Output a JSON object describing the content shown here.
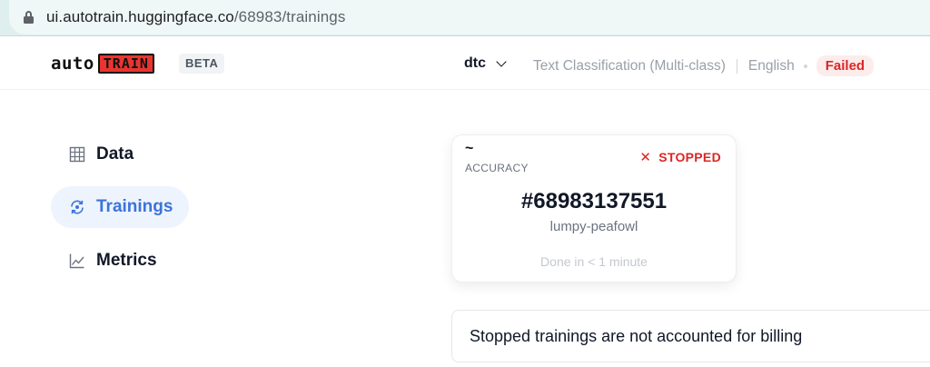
{
  "browser": {
    "url_host": "ui.autotrain.huggingface.co",
    "url_path": "/68983/trainings"
  },
  "header": {
    "logo_auto": "auto",
    "logo_train": "TRAIN",
    "beta_label": "BETA",
    "project_name": "dtc",
    "task": "Text Classification (Multi-class)",
    "language": "English",
    "status": "Failed"
  },
  "sidebar": {
    "items": [
      {
        "label": "Data",
        "icon": "grid-icon",
        "active": false
      },
      {
        "label": "Trainings",
        "icon": "refresh-icon",
        "active": true
      },
      {
        "label": "Metrics",
        "icon": "chart-line-icon",
        "active": false
      }
    ]
  },
  "training_card": {
    "metric_value": "~",
    "metric_label": "ACCURACY",
    "status": "STOPPED",
    "run_id": "#68983137551",
    "run_name": "lumpy-peafowl",
    "duration": "Done in < 1 minute"
  },
  "notice": {
    "text": "Stopped trainings are not accounted for billing"
  },
  "colors": {
    "accent": "#3b73db",
    "danger": "#dc2626",
    "url_bar": "#dfeeee"
  }
}
